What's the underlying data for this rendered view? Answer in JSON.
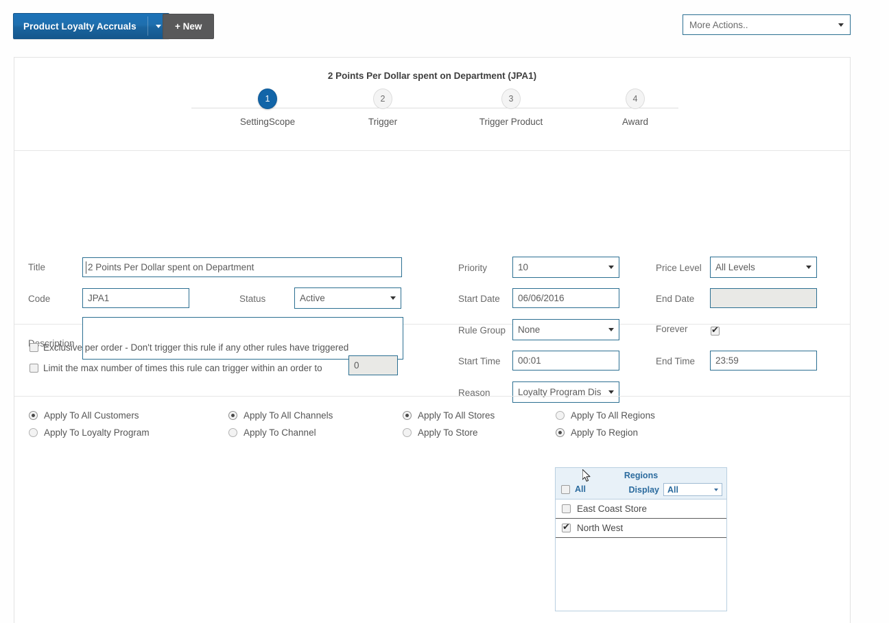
{
  "toolbar": {
    "entity_button_label": "Product Loyalty Accruals",
    "entity_caret_icon": "chevron-down-icon",
    "new_button_label": "+ New",
    "more_actions_label": "More Actions..",
    "more_actions_caret_icon": "chevron-down-icon"
  },
  "wizard": {
    "rule_title": "2 Points Per Dollar spent on Department (JPA1)",
    "steps": [
      {
        "number": "1",
        "label": "SettingScope",
        "state": "active"
      },
      {
        "number": "2",
        "label": "Trigger",
        "state": "idle"
      },
      {
        "number": "3",
        "label": "Trigger Product",
        "state": "idle"
      },
      {
        "number": "4",
        "label": "Award",
        "state": "idle"
      }
    ]
  },
  "form": {
    "title": {
      "label": "Title",
      "value": "2 Points Per Dollar spent on Department"
    },
    "code": {
      "label": "Code",
      "value": "JPA1"
    },
    "status": {
      "label": "Status",
      "value": "Active"
    },
    "description": {
      "label": "Description",
      "value": ""
    },
    "priority": {
      "label": "Priority",
      "value": "10"
    },
    "start_date": {
      "label": "Start Date",
      "value": "06/06/2016"
    },
    "rule_group": {
      "label": "Rule Group",
      "value": "None"
    },
    "start_time": {
      "label": "Start Time",
      "value": "00:01"
    },
    "reason": {
      "label": "Reason",
      "value": "Loyalty Program Dis"
    },
    "price_level": {
      "label": "Price Level",
      "value": "All Levels"
    },
    "end_date": {
      "label": "End Date",
      "value": ""
    },
    "forever": {
      "label": "Forever",
      "checked": true
    },
    "end_time": {
      "label": "End Time",
      "value": "23:59"
    }
  },
  "options": {
    "exclusive": {
      "label": "Exclusive per order - Don't trigger this rule if any other rules have triggered",
      "checked": false
    },
    "limit": {
      "label": "Limit the max number of times this rule can trigger within an order to",
      "checked": false,
      "value": "0"
    }
  },
  "scope": {
    "customers": [
      {
        "label": "Apply To All Customers",
        "selected": true
      },
      {
        "label": "Apply To Loyalty Program",
        "selected": false
      }
    ],
    "channels": [
      {
        "label": "Apply To All Channels",
        "selected": true
      },
      {
        "label": "Apply To Channel",
        "selected": false
      }
    ],
    "stores": [
      {
        "label": "Apply To All Stores",
        "selected": true
      },
      {
        "label": "Apply To Store",
        "selected": false
      }
    ],
    "regions": [
      {
        "label": "Apply To All Regions",
        "selected": false
      },
      {
        "label": "Apply To Region",
        "selected": true
      }
    ]
  },
  "regions_panel": {
    "title": "Regions",
    "all_label": "All",
    "all_checked": false,
    "display_label": "Display",
    "display_value": "All",
    "rows": [
      {
        "label": "East Coast Store",
        "checked": false
      },
      {
        "label": "North West",
        "checked": true
      }
    ]
  },
  "colors": {
    "brand_blue": "#1265a8",
    "button_grey": "#59595a",
    "field_border": "#2a6e91",
    "panel_header": "#e8f1f8",
    "panel_text": "#2b6b9e"
  }
}
